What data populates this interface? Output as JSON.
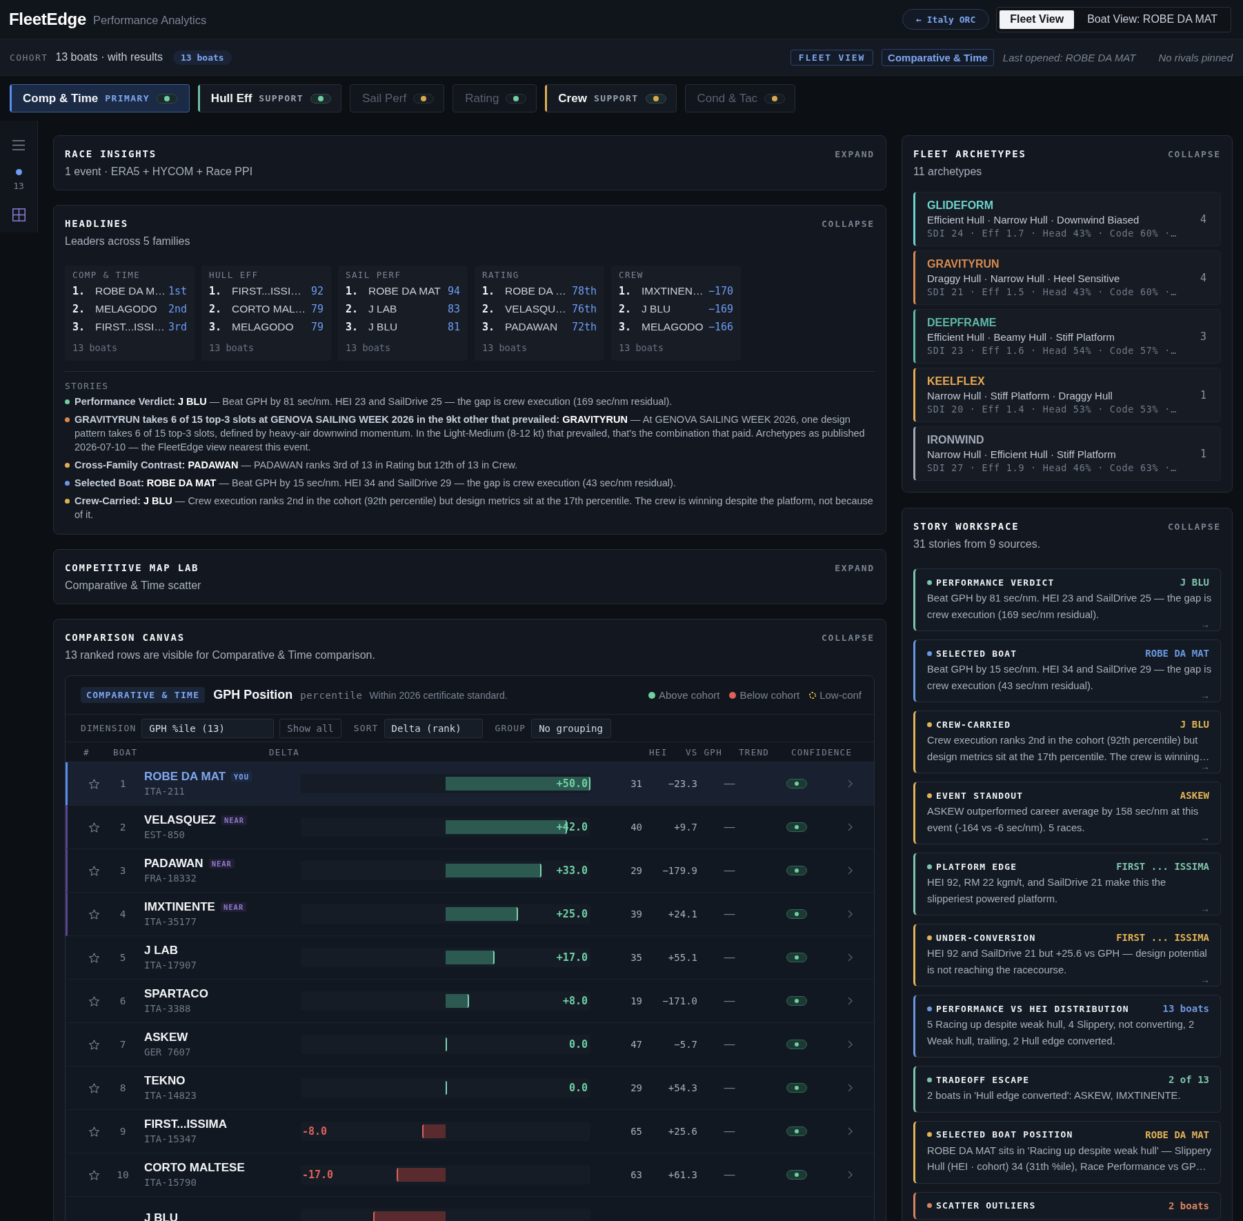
{
  "header": {
    "brand": "FleetEdge",
    "subtitle": "Performance Analytics",
    "back_button": "← Italy ORC",
    "views": [
      {
        "label": "Fleet View",
        "selected": true
      },
      {
        "label": "Boat View: ROBE DA MAT",
        "selected": false
      }
    ]
  },
  "cohort_bar": {
    "label": "COHORT",
    "summary": "13 boats · with results",
    "count": "13 boats",
    "view_badge": "FLEET VIEW",
    "family_badge": "Comparative & Time",
    "last_opened": "Last opened: ROBE DA MAT",
    "rivals": "No rivals pinned"
  },
  "family_tabs": [
    {
      "label": "Comp & Time",
      "role": "PRIMARY",
      "selected": true,
      "disabled": false,
      "color": "#5b8def",
      "status": {
        "color": "#6fcf9f"
      }
    },
    {
      "label": "Hull Eff",
      "role": "SUPPORT",
      "selected": false,
      "disabled": false,
      "color": "#6fbfa5",
      "status": {
        "color": "#6fcf9f"
      }
    },
    {
      "label": "Sail Perf",
      "selected": false,
      "disabled": true,
      "status": {
        "color": "#d9a84a"
      }
    },
    {
      "label": "Rating",
      "selected": false,
      "disabled": true,
      "status": {
        "color": "#6fcf9f"
      }
    },
    {
      "label": "Crew",
      "role": "SUPPORT",
      "selected": false,
      "disabled": false,
      "color": "#e0ae55",
      "status": {
        "color": "#d9a84a"
      }
    },
    {
      "label": "Cond & Tac",
      "selected": false,
      "disabled": true,
      "status": {
        "color": "#d9a84a"
      }
    }
  ],
  "rail": {
    "count": "13"
  },
  "race_insights": {
    "title": "RACE INSIGHTS",
    "action": "EXPAND",
    "subtitle": "1 event · ERA5 + HYCOM + Race PPI"
  },
  "headlines": {
    "title": "HEADLINES",
    "action": "COLLAPSE",
    "subtitle": "Leaders across 5 families",
    "families": [
      {
        "title": "COMP & TIME",
        "leaders": [
          {
            "rank": "1.",
            "name": "ROBE DA M…",
            "value": "1st"
          },
          {
            "rank": "2.",
            "name": "MELAGODO",
            "value": "2nd"
          },
          {
            "rank": "3.",
            "name": "FIRST...ISSI…",
            "value": "3rd"
          }
        ],
        "footer": "13 boats"
      },
      {
        "title": "HULL EFF",
        "leaders": [
          {
            "rank": "1.",
            "name": "FIRST...ISSI…",
            "value": "92"
          },
          {
            "rank": "2.",
            "name": "CORTO MAL…",
            "value": "79"
          },
          {
            "rank": "3.",
            "name": "MELAGODO",
            "value": "79"
          }
        ],
        "footer": "13 boats"
      },
      {
        "title": "SAIL PERF",
        "leaders": [
          {
            "rank": "1.",
            "name": "ROBE DA MAT",
            "value": "94"
          },
          {
            "rank": "2.",
            "name": "J LAB",
            "value": "83"
          },
          {
            "rank": "3.",
            "name": "J BLU",
            "value": "81"
          }
        ],
        "footer": "13 boats"
      },
      {
        "title": "RATING",
        "leaders": [
          {
            "rank": "1.",
            "name": "ROBE DA …",
            "value": "78th"
          },
          {
            "rank": "2.",
            "name": "VELASQU…",
            "value": "76th"
          },
          {
            "rank": "3.",
            "name": "PADAWAN",
            "value": "72th"
          }
        ],
        "footer": "13 boats"
      },
      {
        "title": "CREW",
        "leaders": [
          {
            "rank": "1.",
            "name": "IMXTINEN…",
            "value": "−170"
          },
          {
            "rank": "2.",
            "name": "J BLU",
            "value": "−169"
          },
          {
            "rank": "3.",
            "name": "MELAGODO",
            "value": "−166"
          }
        ],
        "footer": "13 boats"
      }
    ],
    "stories_label": "STORIES",
    "stories": [
      {
        "color": "#6fcf9f",
        "lead": "Performance Verdict:",
        "subject": "J BLU",
        "text": "— Beat GPH by 81 sec/nm. HEI 23 and SailDrive 25 — the gap is crew execution (169 sec/nm residual)."
      },
      {
        "color": "#d98a4f",
        "lead": "GRAVITYRUN takes 6 of 15 top-3 slots at GENOVA SAILING WEEK 2026 in the 9kt other that prevailed:",
        "subject": "GRAVITYRUN",
        "text": "— At GENOVA SAILING WEEK 2026, one design pattern takes 6 of 15 top-3 slots, defined by heavy-air downwind momentum. In the Light-Medium (8-12 kt) that prevailed, that's the combination that paid. Archetypes as published 2026-07-10 — the FleetEdge view nearest this event."
      },
      {
        "color": "#e0b050",
        "lead": "Cross-Family Contrast:",
        "subject": "PADAWAN",
        "text": "— PADAWAN ranks 3rd of 13 in Rating but 12th of 13 in Crew."
      },
      {
        "color": "#6d95e8",
        "lead": "Selected Boat:",
        "subject": "ROBE DA MAT",
        "text": "— Beat GPH by 15 sec/nm. HEI 34 and SailDrive 29 — the gap is crew execution (43 sec/nm residual)."
      },
      {
        "color": "#e0b050",
        "lead": "Crew-Carried:",
        "subject": "J BLU",
        "text": "— Crew execution ranks 2nd in the cohort (92th percentile) but design metrics sit at the 17th percentile. The crew is winning despite the platform, not because of it."
      }
    ]
  },
  "competitive_map_lab": {
    "title": "COMPETITIVE MAP LAB",
    "action": "EXPAND",
    "subtitle": "Comparative & Time scatter"
  },
  "comparison_canvas": {
    "title": "COMPARISON CANVAS",
    "action": "COLLAPSE",
    "subtitle": "13 ranked rows are visible for Comparative & Time comparison.",
    "chart": {
      "family_tag": "COMPARATIVE & TIME",
      "metric": "GPH Position",
      "unit": "percentile",
      "note": "Within 2026 certificate standard.",
      "legend": [
        {
          "kind": "dot",
          "label": "Above cohort",
          "color": "#6fcf9f"
        },
        {
          "kind": "dot",
          "label": "Below cohort",
          "color": "#e0605a"
        },
        {
          "kind": "ring",
          "label": "Low-conf",
          "color": "#d9b44a"
        }
      ],
      "controls": [
        {
          "kind": "label",
          "text": "DIMENSION"
        },
        {
          "kind": "select",
          "text": "GPH %ile (13)"
        },
        {
          "kind": "button",
          "text": "Show all"
        },
        {
          "kind": "label",
          "text": "SORT"
        },
        {
          "kind": "select",
          "text": "Delta (rank)"
        },
        {
          "kind": "label",
          "text": "GROUP"
        },
        {
          "kind": "select",
          "text": "No grouping"
        }
      ],
      "columns": [
        "#",
        "BOAT",
        "DELTA",
        "HEI",
        "VS GPH",
        "TREND",
        "CONFIDENCE"
      ],
      "rows": [
        {
          "rank": "1",
          "name": "ROBE DA MAT",
          "badge": {
            "kind": "you",
            "label": "YOU"
          },
          "sail": "ITA-211",
          "selected": true,
          "pinned": false,
          "delta": {
            "text": "+50.0",
            "kind": "above",
            "level": 1
          },
          "hei": "31",
          "vs_gph": "−23.3",
          "trend": "—",
          "low_confidence": false
        },
        {
          "rank": "2",
          "name": "VELASQUEZ",
          "badge": {
            "kind": "near",
            "label": "NEAR"
          },
          "sail": "EST-850",
          "selected": false,
          "pinned": false,
          "delta": {
            "text": "+42.0",
            "kind": "above",
            "level": 0.84
          },
          "hei": "40",
          "vs_gph": "+9.7",
          "trend": "—",
          "low_confidence": false
        },
        {
          "rank": "3",
          "name": "PADAWAN",
          "badge": {
            "kind": "near",
            "label": "NEAR"
          },
          "sail": "FRA-18332",
          "selected": false,
          "pinned": false,
          "delta": {
            "text": "+33.0",
            "kind": "above",
            "level": 0.66
          },
          "hei": "29",
          "vs_gph": "−179.9",
          "trend": "—",
          "low_confidence": false
        },
        {
          "rank": "4",
          "name": "IMXTINENTE",
          "badge": {
            "kind": "near",
            "label": "NEAR"
          },
          "sail": "ITA-35177",
          "selected": false,
          "pinned": false,
          "delta": {
            "text": "+25.0",
            "kind": "above",
            "level": 0.5
          },
          "hei": "39",
          "vs_gph": "+24.1",
          "trend": "—",
          "low_confidence": false
        },
        {
          "rank": "5",
          "name": "J LAB",
          "sail": "ITA-17907",
          "selected": false,
          "pinned": false,
          "delta": {
            "text": "+17.0",
            "kind": "above",
            "level": 0.34
          },
          "hei": "35",
          "vs_gph": "+55.1",
          "trend": "—",
          "low_confidence": false
        },
        {
          "rank": "6",
          "name": "SPARTACO",
          "sail": "ITA-3388",
          "selected": false,
          "pinned": false,
          "delta": {
            "text": "+8.0",
            "kind": "above",
            "level": 0.16
          },
          "hei": "19",
          "vs_gph": "−171.0",
          "trend": "—",
          "low_confidence": false
        },
        {
          "rank": "7",
          "name": "ASKEW",
          "sail": "GER 7607",
          "selected": false,
          "pinned": false,
          "delta": {
            "text": "0.0",
            "kind": "above",
            "level": 0
          },
          "hei": "47",
          "vs_gph": "−5.7",
          "trend": "—",
          "low_confidence": false
        },
        {
          "rank": "8",
          "name": "TEKNO",
          "sail": "ITA-14823",
          "selected": false,
          "pinned": false,
          "delta": {
            "text": "0.0",
            "kind": "above",
            "level": 0
          },
          "hei": "29",
          "vs_gph": "+54.3",
          "trend": "—",
          "low_confidence": false
        },
        {
          "rank": "9",
          "name": "FIRST...ISSIMA",
          "sail": "ITA-15347",
          "selected": false,
          "pinned": false,
          "delta": {
            "text": "-8.0",
            "kind": "below",
            "level": 0.16
          },
          "hei": "65",
          "vs_gph": "+25.6",
          "trend": "—",
          "low_confidence": false
        },
        {
          "rank": "10",
          "name": "CORTO MALTESE",
          "sail": "ITA-15790",
          "selected": false,
          "pinned": false,
          "delta": {
            "text": "-17.0",
            "kind": "below",
            "level": 0.34
          },
          "hei": "63",
          "vs_gph": "+61.3",
          "trend": "—",
          "low_confidence": false
        },
        {
          "name": "J BLU",
          "selected": false,
          "delta": {
            "kind": "below",
            "level": 0.5
          }
        }
      ]
    }
  },
  "fleet_archetypes": {
    "title": "FLEET ARCHETYPES",
    "action": "COLLAPSE",
    "subtitle": "11 archetypes",
    "items": [
      {
        "name": "GLIDEFORM",
        "color": "#6fd3cc",
        "traits": "Efficient Hull · Narrow Hull · Downwind Biased",
        "stats": "SDI 24 · Eff 1.7 · Head 43% · Code 60% ·…",
        "count": "4"
      },
      {
        "name": "GRAVITYRUN",
        "color": "#d98b4e",
        "traits": "Draggy Hull · Narrow Hull · Heel Sensitive",
        "stats": "SDI 21 · Eff 1.5 · Head 43% · Code 60% ·…",
        "count": "4"
      },
      {
        "name": "DEEPFRAME",
        "color": "#5fb9a9",
        "traits": "Efficient Hull · Beamy Hull · Stiff Platform",
        "stats": "SDI 23 · Eff 1.6 · Head 54% · Code 57% ·…",
        "count": "3"
      },
      {
        "name": "KEELFLEX",
        "color": "#e8aa52",
        "traits": "Narrow Hull · Stiff Platform · Draggy Hull",
        "stats": "SDI 20 · Eff 1.4 · Head 53% · Code 53% ·…",
        "count": "1"
      },
      {
        "name": "IRONWIND",
        "color": "#a3aab6",
        "traits": "Narrow Hull · Efficient Hull · Stiff Platform",
        "stats": "SDI 27 · Eff 1.9 · Head 46% · Code 63% ·…",
        "count": "1"
      }
    ]
  },
  "story_workspace": {
    "title": "STORY WORKSPACE",
    "action": "COLLAPSE",
    "subtitle": "31 stories from 9 sources.",
    "cards": [
      {
        "title": "PERFORMANCE VERDICT",
        "tag": "J BLU",
        "color": "#7fc4ad",
        "body": "Beat GPH by 81 sec/nm. HEI 23 and SailDrive 25 — the gap is crew execution (169 sec/nm residual).",
        "arrow": "→"
      },
      {
        "title": "SELECTED BOAT",
        "tag": "ROBE DA MAT",
        "color": "#6a98e0",
        "body": "Beat GPH by 15 sec/nm. HEI 34 and SailDrive 29 — the gap is crew execution (43 sec/nm residual).",
        "arrow": "→"
      },
      {
        "title": "CREW-CARRIED",
        "tag": "J BLU",
        "color": "#e2b356",
        "body": "Crew execution ranks 2nd in the cohort (92th percentile) but design metrics sit at the 17th percentile. The crew is winning…",
        "arrow": "→"
      },
      {
        "title": "EVENT STANDOUT",
        "tag": "ASKEW",
        "color": "#e2b356",
        "body": "ASKEW outperformed career average by 158 sec/nm at this event (-164 vs -6 sec/nm). 5 races.",
        "arrow": "→"
      },
      {
        "title": "PLATFORM EDGE",
        "tag": "FIRST ... ISSIMA",
        "color": "#7fc4ad",
        "body": "HEI 92, RM 22 kgm/t, and SailDrive 21 make this the slipperiest powered platform.",
        "arrow": "→"
      },
      {
        "title": "UNDER-CONVERSION",
        "tag": "FIRST ... ISSIMA",
        "color": "#e2b356",
        "body": "HEI 92 and SailDrive 21 but +25.6 vs GPH — design potential is not reaching the racecourse.",
        "arrow": "→"
      },
      {
        "title": "PERFORMANCE VS HEI DISTRIBUTION",
        "tag": "13 boats",
        "color": "#6a98e0",
        "body": "5 Racing up despite weak hull, 4 Slippery, not converting, 2 Weak hull, trailing, 2 Hull edge converted."
      },
      {
        "title": "TRADEOFF ESCAPE",
        "tag": "2 of 13",
        "color": "#7fc4ad",
        "body": "2 boats in 'Hull edge converted': ASKEW, IMXTINENTE."
      },
      {
        "title": "SELECTED BOAT POSITION",
        "tag": "ROBE DA MAT",
        "color": "#e2b356",
        "body": "ROBE DA MAT sits in 'Racing up despite weak hull' — Slippery Hull (HEI · cohort) 34 (31th %ile), Race Performance vs GP…"
      },
      {
        "title": "SCATTER OUTLIERS",
        "tag": "2 boats",
        "color": "#d9825f"
      }
    ]
  }
}
